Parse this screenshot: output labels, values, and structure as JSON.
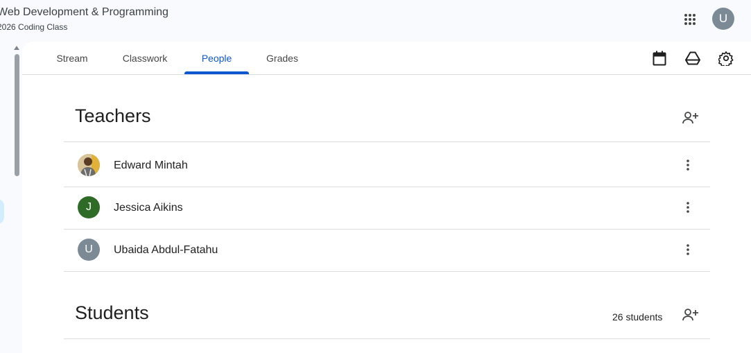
{
  "header": {
    "class_title": "Web Development & Programming",
    "class_subtitle": "2026 Coding Class",
    "account_initial": "U"
  },
  "tabs": [
    {
      "label": "Stream"
    },
    {
      "label": "Classwork"
    },
    {
      "label": "People",
      "active": true
    },
    {
      "label": "Grades"
    }
  ],
  "toolbar_icons": [
    "calendar-icon",
    "drive-icon",
    "settings-gear-icon"
  ],
  "teachers": {
    "title": "Teachers",
    "list": [
      {
        "name": "Edward Mintah",
        "initial": "",
        "avatar": "photo"
      },
      {
        "name": "Jessica Aikins",
        "initial": "J",
        "avatar_color": "#2e6b26"
      },
      {
        "name": "Ubaida Abdul-Fatahu",
        "initial": "U",
        "avatar_color": "#7b8a95"
      }
    ]
  },
  "students": {
    "title": "Students",
    "count_label": "26 students"
  },
  "colors": {
    "accent": "#0b57d0",
    "background": "#f8fafd",
    "panel": "#ffffff",
    "divider": "#dadce0"
  }
}
